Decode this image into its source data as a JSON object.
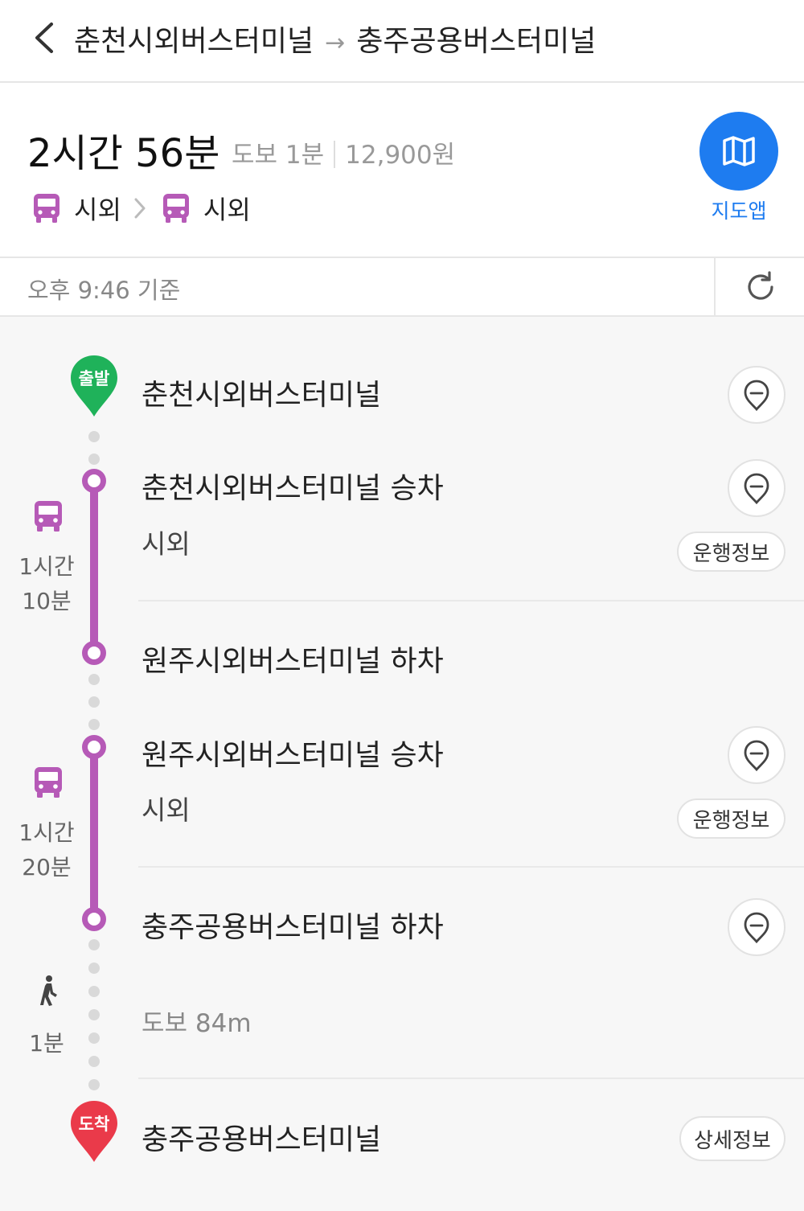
{
  "header": {
    "origin": "춘천시외버스터미널",
    "arrow": "→",
    "destination": "충주공용버스터미널"
  },
  "summary": {
    "total_time": "2시간 56분",
    "walk": "도보 1분",
    "fare": "12,900원",
    "modes": [
      "시외",
      "시외"
    ],
    "map_button_label": "지도앱"
  },
  "timebar": {
    "basis": "오후 9:46 기준"
  },
  "timeline": {
    "start_badge": "출발",
    "end_badge": "도착",
    "start_name": "춘천시외버스터미널",
    "segments": [
      {
        "board": "춘천시외버스터미널 승차",
        "mode": "시외",
        "info_button": "운행정보",
        "duration_line1": "1시간",
        "duration_line2": "10분",
        "alight": "원주시외버스터미널 하차"
      },
      {
        "board": "원주시외버스터미널 승차",
        "mode": "시외",
        "info_button": "운행정보",
        "duration_line1": "1시간",
        "duration_line2": "20분",
        "alight": "충주공용버스터미널 하차"
      }
    ],
    "walk": {
      "text": "도보 84m",
      "duration": "1분"
    },
    "end_name": "충주공용버스터미널",
    "detail_button": "상세정보"
  },
  "colors": {
    "accent_blue": "#1e7cf0",
    "bus_purple": "#b65ab7",
    "start_green": "#1fb25a",
    "end_red": "#ea3a4a"
  },
  "icons": [
    "back-icon",
    "bus-icon",
    "chevron-right-icon",
    "map-icon",
    "refresh-icon",
    "location-pin-icon",
    "walk-icon"
  ]
}
